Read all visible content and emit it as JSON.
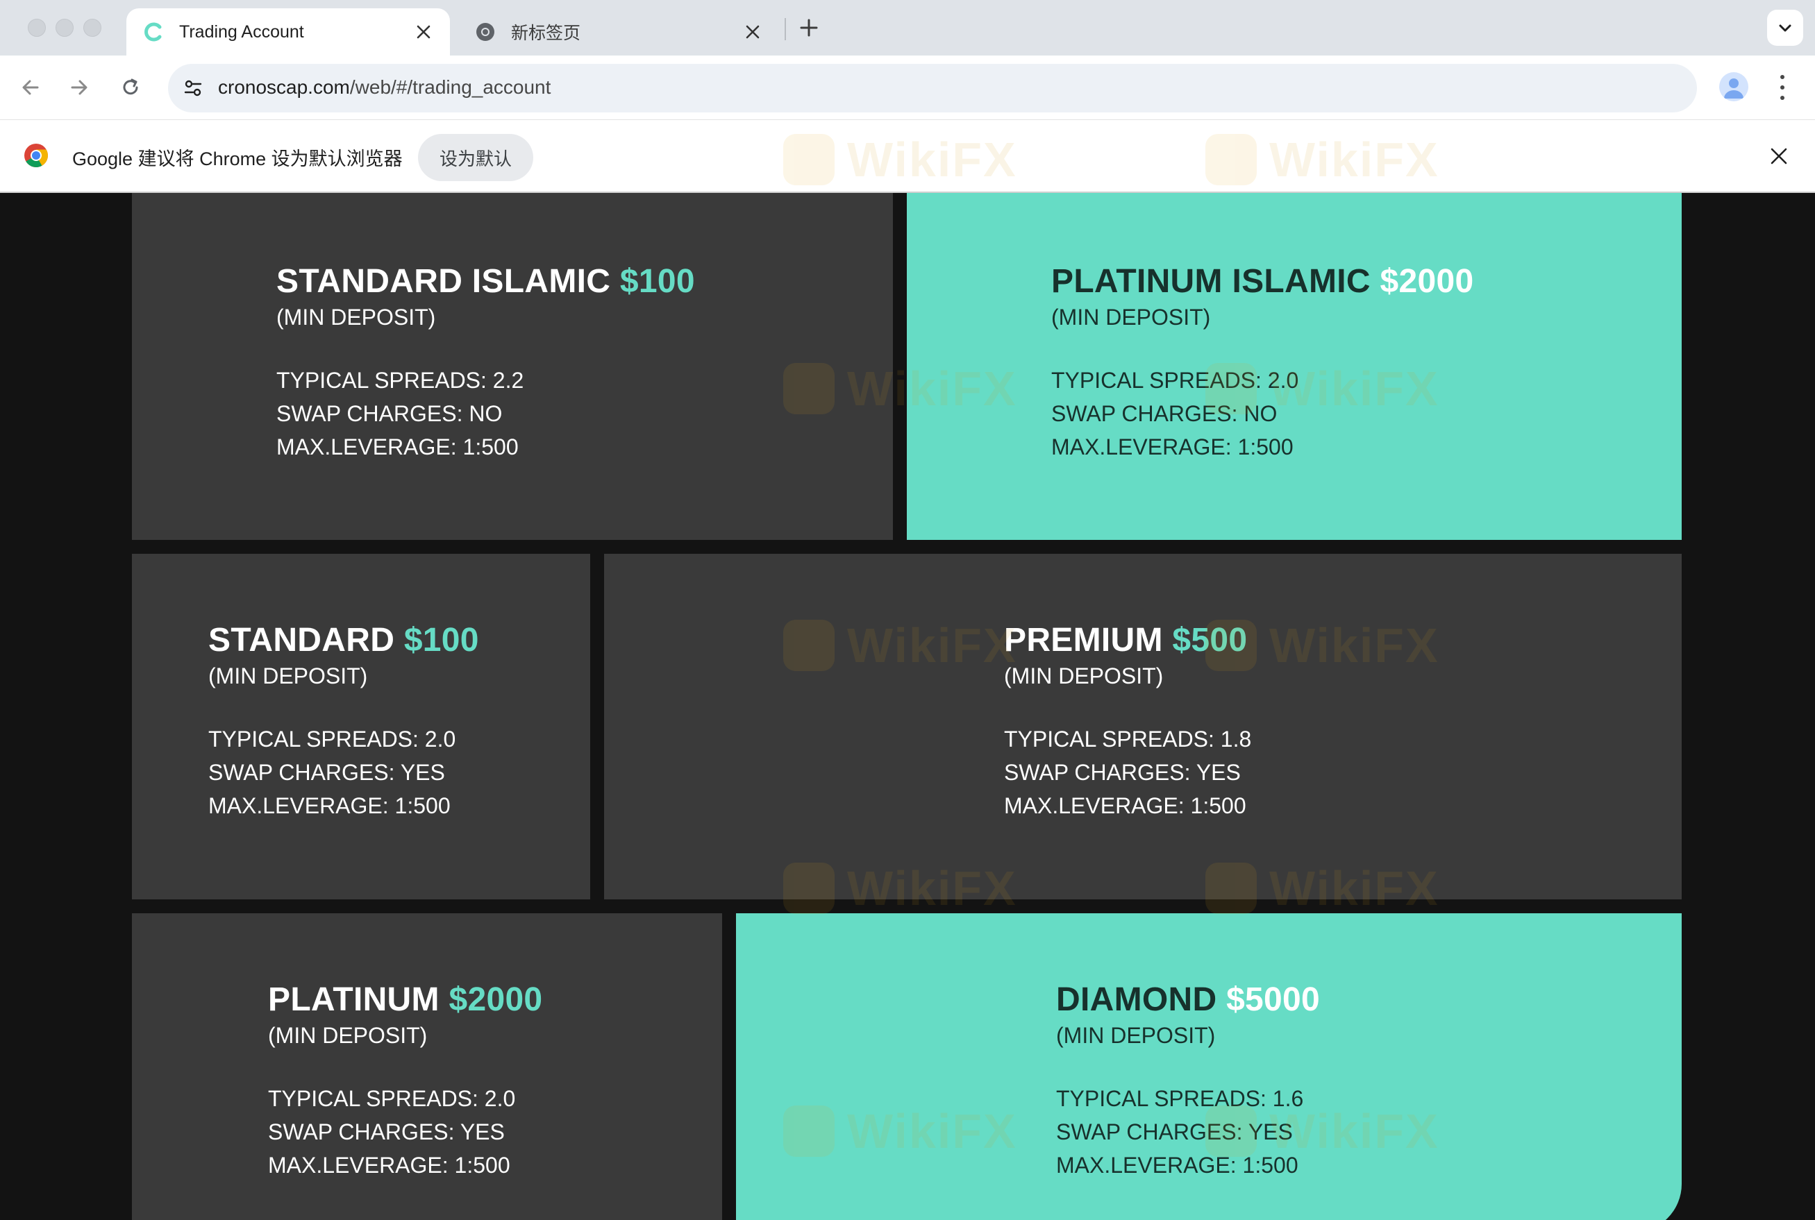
{
  "browser": {
    "tabs": [
      {
        "title": "Trading Account",
        "active": true,
        "favicon": "cronos-c-icon"
      },
      {
        "title": "新标签页",
        "active": false,
        "favicon": "chrome-icon"
      }
    ],
    "url_host": "cronoscap.com",
    "url_path": "/web/#/trading_account",
    "infobar": {
      "message": "Google 建议将 Chrome 设为默认浏览器",
      "button_label": "设为默认"
    }
  },
  "watermark": "WikiFX",
  "accounts": [
    {
      "name": "STANDARD ISLAMIC",
      "price": "$100",
      "sub": "(MIN DEPOSIT)",
      "spreads": "TYPICAL SPREADS: 2.2",
      "swap": "SWAP CHARGES: NO",
      "leverage": "MAX.LEVERAGE: 1:500",
      "theme": "dark"
    },
    {
      "name": "PLATINUM ISLAMIC",
      "price": "$2000",
      "sub": "(MIN DEPOSIT)",
      "spreads": "TYPICAL SPREADS: 2.0",
      "swap": "SWAP CHARGES: NO",
      "leverage": "MAX.LEVERAGE: 1:500",
      "theme": "teal"
    },
    {
      "name": "STANDARD",
      "price": "$100",
      "sub": "(MIN DEPOSIT)",
      "spreads": "TYPICAL SPREADS: 2.0",
      "swap": "SWAP CHARGES: YES",
      "leverage": "MAX.LEVERAGE: 1:500",
      "theme": "dark"
    },
    {
      "name": "PREMIUM",
      "price": "$500",
      "sub": "(MIN DEPOSIT)",
      "spreads": "TYPICAL SPREADS: 1.8",
      "swap": "SWAP CHARGES: YES",
      "leverage": "MAX.LEVERAGE: 1:500",
      "theme": "dark"
    },
    {
      "name": "PLATINUM",
      "price": "$2000",
      "sub": "(MIN DEPOSIT)",
      "spreads": "TYPICAL SPREADS: 2.0",
      "swap": "SWAP CHARGES: YES",
      "leverage": "MAX.LEVERAGE: 1:500",
      "theme": "dark"
    },
    {
      "name": "DIAMOND",
      "price": "$5000",
      "sub": "(MIN DEPOSIT)",
      "spreads": "TYPICAL SPREADS: 1.6",
      "swap": "SWAP CHARGES: YES",
      "leverage": "MAX.LEVERAGE: 1:500",
      "theme": "teal"
    }
  ],
  "colors": {
    "accent_teal": "#66dcc5",
    "card_dark": "#3a3a3a",
    "page_bg": "#131313"
  }
}
